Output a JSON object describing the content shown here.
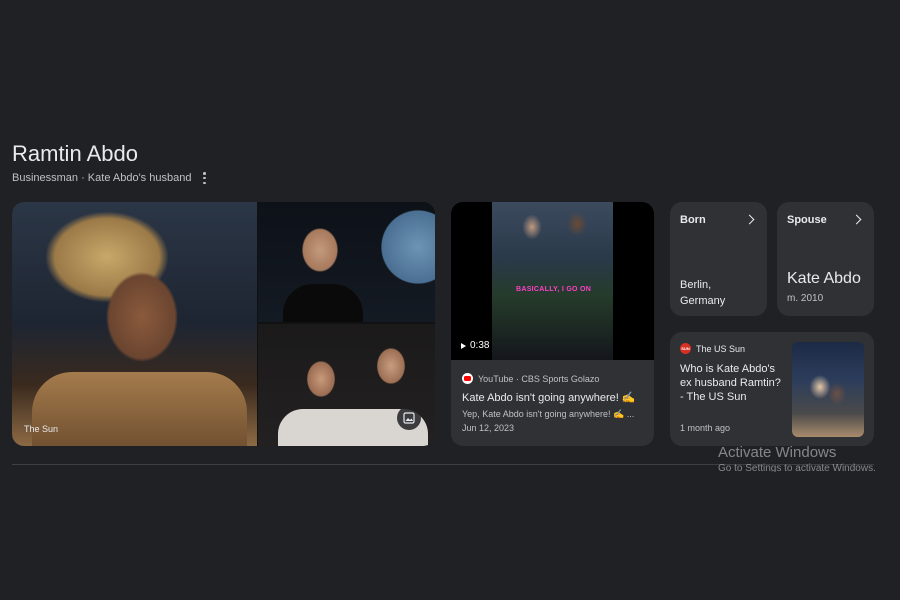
{
  "header": {
    "title": "Ramtin Abdo",
    "subtitle": "Businessman · Kate Abdo's husband"
  },
  "gallery": {
    "credit": "The Sun"
  },
  "video": {
    "duration": "0:38",
    "banner_text": "BASICALLY, I GO ON",
    "source": "YouTube · CBS Sports Golazo",
    "title": "Kate Abdo isn't going anywhere! ✍️",
    "snippet": "Yep, Kate Abdo isn't going anywhere! ✍️ ...",
    "date": "Jun 12, 2023"
  },
  "born": {
    "label": "Born",
    "place_line1": "Berlin,",
    "place_line2": "Germany"
  },
  "spouse": {
    "label": "Spouse",
    "name": "Kate Abdo",
    "detail": "m. 2010"
  },
  "news": {
    "source": "The US Sun",
    "icon_text": "SUN",
    "title": "Who is Kate Abdo's ex husband Ramtin? - The US Sun",
    "time": "1 month ago"
  },
  "watermark": {
    "title": "Activate Windows",
    "subtitle": "Go to Settings to activate Windows."
  },
  "colors": {
    "background": "#202124",
    "card": "#303134",
    "text": "#e8eaed",
    "muted": "#bdc1c6"
  }
}
